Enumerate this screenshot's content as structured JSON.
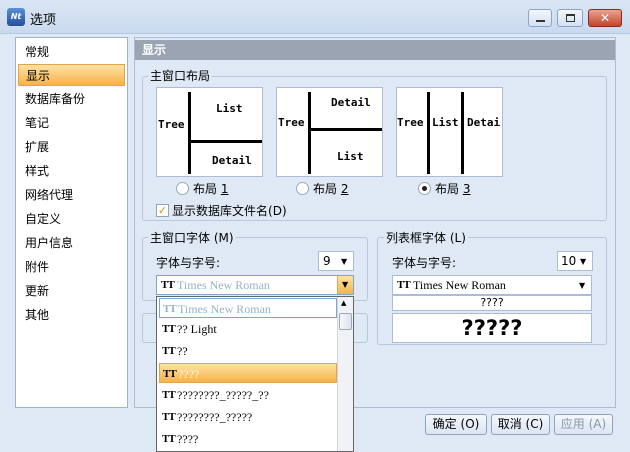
{
  "window": {
    "title": "选项",
    "app_icon_text": "Nt"
  },
  "sidebar": {
    "items": [
      {
        "label": "常规",
        "selected": false
      },
      {
        "label": "显示",
        "selected": true
      },
      {
        "label": "数据库备份",
        "selected": false
      },
      {
        "label": "笔记",
        "selected": false
      },
      {
        "label": "扩展",
        "selected": false
      },
      {
        "label": "样式",
        "selected": false
      },
      {
        "label": "网络代理",
        "selected": false
      },
      {
        "label": "自定义",
        "selected": false
      },
      {
        "label": "用户信息",
        "selected": false
      },
      {
        "label": "附件",
        "selected": false
      },
      {
        "label": "更新",
        "selected": false
      },
      {
        "label": "其他",
        "selected": false
      }
    ]
  },
  "display": {
    "header": "显示",
    "layout_group": {
      "title": "主窗口布局",
      "thumb1": {
        "tree": "Tree",
        "list": "List",
        "detail": "Detail"
      },
      "thumb2": {
        "tree": "Tree",
        "detail": "Detail",
        "list": "List"
      },
      "thumb3": {
        "tree": "Tree",
        "list": "List",
        "detail": "Detai"
      },
      "options": [
        {
          "label": "布局",
          "num": "1",
          "selected": false
        },
        {
          "label": "布局",
          "num": "2",
          "selected": false
        },
        {
          "label": "布局",
          "num": "3",
          "selected": true
        }
      ],
      "show_db_filename": {
        "label": "显示数据库文件名",
        "key": "(D)",
        "checked": true
      }
    },
    "main_font_group": {
      "title": "主窗口字体",
      "key": "(M)",
      "font_label": "字体与字号:",
      "size": "9",
      "font_value": "Times New Roman"
    },
    "list_font_group": {
      "title": "列表框字体",
      "key": "(L)",
      "font_label": "字体与字号:",
      "size": "10",
      "font_value": "Times New Roman",
      "preview_small": "????",
      "preview_large": "?????"
    }
  },
  "font_dropdown": {
    "items": [
      {
        "label": "Times New Roman"
      },
      {
        "label": "?? Light"
      },
      {
        "label": "??"
      },
      {
        "label": "????"
      },
      {
        "label": "????????_?????_??"
      },
      {
        "label": "????????_?????"
      },
      {
        "label": "????"
      }
    ],
    "selected_index": 3,
    "icon_text": "TT"
  },
  "buttons": {
    "ok": {
      "label": "确定",
      "key": "(O)"
    },
    "cancel": {
      "label": "取消",
      "key": "(C)"
    },
    "apply": {
      "label": "应用",
      "key": "(A)"
    }
  },
  "colors": {
    "accent": "#f6b24a",
    "header_bar": "#9aa4b3",
    "window_bg": "#dfe9f5",
    "close_button": "#c4432a"
  }
}
